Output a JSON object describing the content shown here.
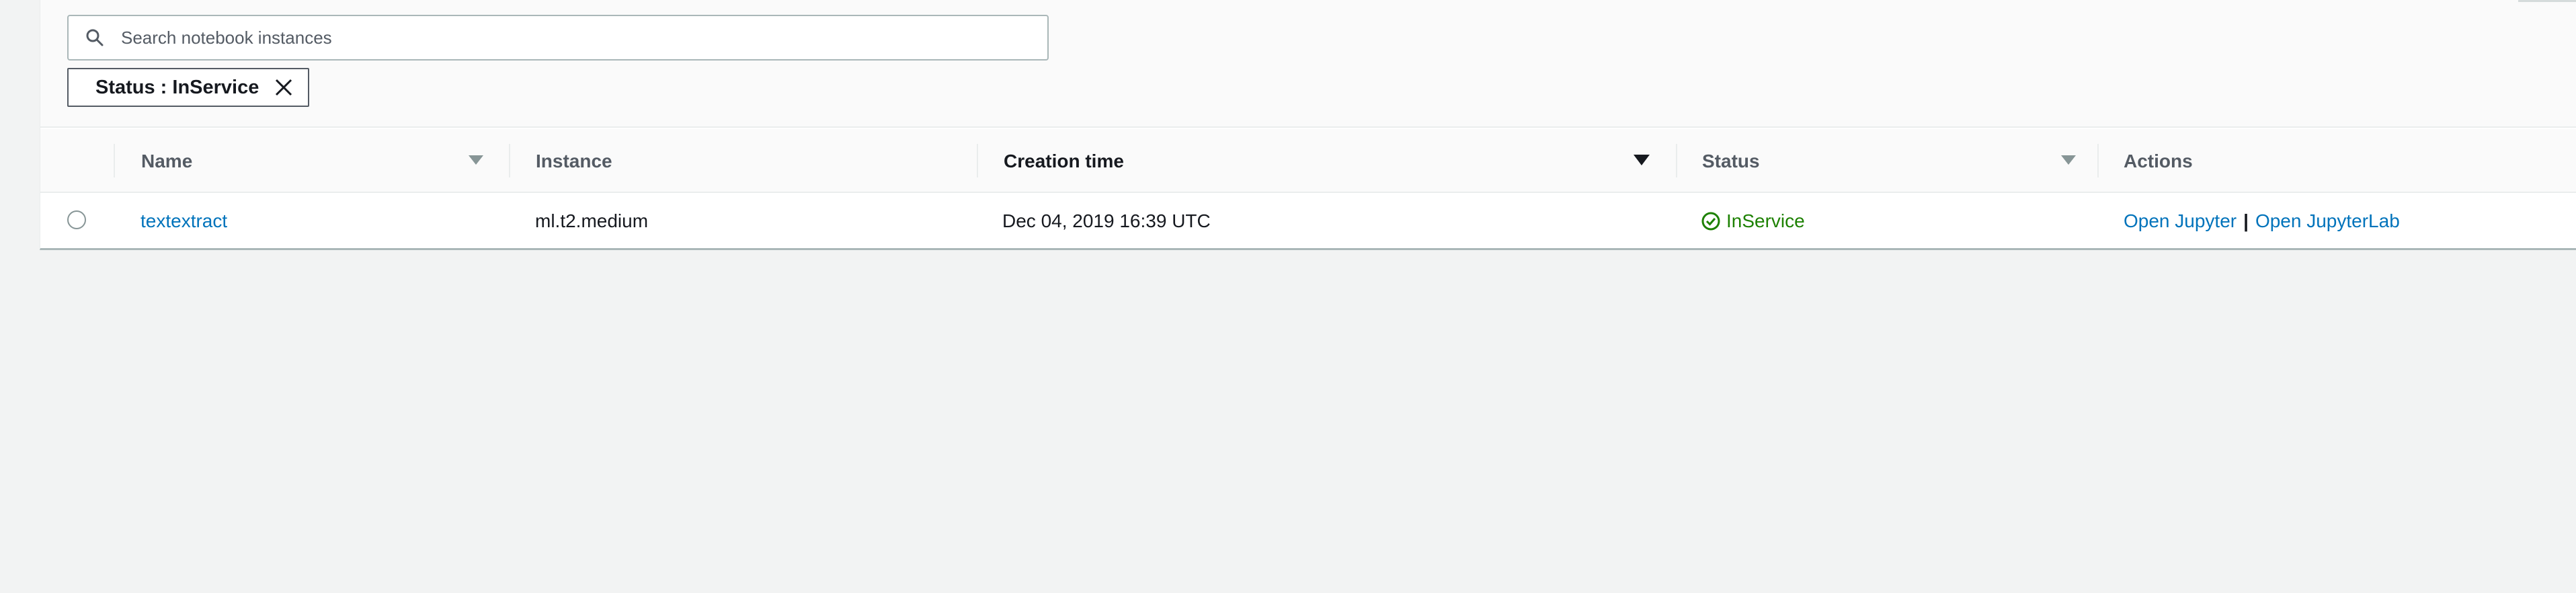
{
  "search": {
    "placeholder": "Search notebook instances",
    "value": ""
  },
  "filter_token": {
    "label": "Status : InService"
  },
  "table": {
    "columns": [
      {
        "label": "Name"
      },
      {
        "label": "Instance"
      },
      {
        "label": "Creation time"
      },
      {
        "label": "Status"
      },
      {
        "label": "Actions"
      }
    ],
    "rows": [
      {
        "name": "textextract",
        "instance": "ml.t2.medium",
        "creation_time": "Dec 04, 2019 16:39 UTC",
        "status": "InService",
        "actions": [
          "Open Jupyter",
          "Open JupyterLab"
        ],
        "action_separator": "|"
      }
    ]
  },
  "colors": {
    "link": "#0073bb",
    "status_ok": "#1d8102",
    "border": "#aab7b8"
  },
  "icons": {
    "search": "search-icon",
    "close": "close-icon",
    "sort": "caret-down-icon",
    "status": "check-circle-icon"
  }
}
